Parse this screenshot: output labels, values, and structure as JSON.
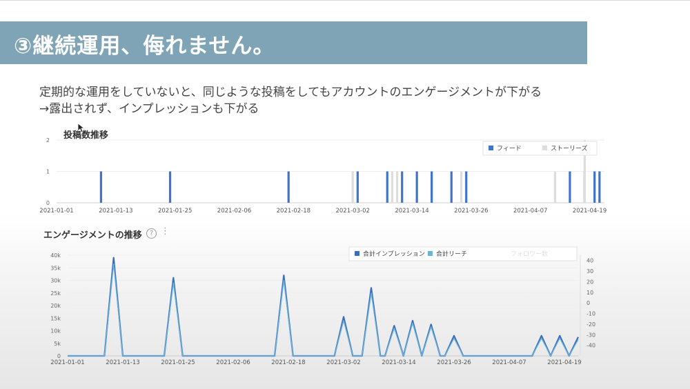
{
  "slide": {
    "title": "③継続運用、侮れません。",
    "desc_line1": "定期的な運用をしていないと、同じような投稿をしてもアカウントのエンゲージメントが下がる",
    "desc_line2": "→露出されず、インプレッションも下がる"
  },
  "icons": {
    "help": "question-circle-icon",
    "more": "vertical-dots-icon",
    "cursor": "mouse-pointer-icon"
  },
  "colors": {
    "banner": "#7fa4b5",
    "feed": "#3f74cc",
    "stories": "#dddddd",
    "impressions": "#3a6fb8",
    "reach": "#6cb3dd"
  },
  "chart_data": [
    {
      "type": "bar",
      "title": "投稿数推移",
      "x_tick_labels": [
        "2021-01-01",
        "2021-01-13",
        "2021-01-25",
        "2021-02-06",
        "2021-02-18",
        "2021-03-02",
        "2021-03-14",
        "2021-03-26",
        "2021-04-07",
        "2021-04-19"
      ],
      "x_range": [
        "2021-01-01",
        "2021-04-22"
      ],
      "y_ticks": [
        "0",
        "1",
        "2"
      ],
      "ylim": [
        0,
        2
      ],
      "legend_position": "top-right",
      "series": [
        {
          "name": "フィード",
          "color": "#3f74cc",
          "points": [
            [
              "2021-01-10",
              1
            ],
            [
              "2021-01-24",
              1
            ],
            [
              "2021-02-17",
              1
            ],
            [
              "2021-03-03",
              1
            ],
            [
              "2021-03-09",
              1
            ],
            [
              "2021-03-12",
              1
            ],
            [
              "2021-03-15",
              1
            ],
            [
              "2021-03-18",
              1
            ],
            [
              "2021-03-22",
              1
            ],
            [
              "2021-03-25",
              1
            ],
            [
              "2021-04-15",
              1
            ],
            [
              "2021-04-18",
              1
            ],
            [
              "2021-04-20",
              1
            ],
            [
              "2021-04-21",
              1
            ]
          ]
        },
        {
          "name": "ストーリーズ",
          "color": "#dddddd",
          "points": [
            [
              "2021-03-02",
              1
            ],
            [
              "2021-03-10",
              1
            ],
            [
              "2021-03-11",
              1
            ],
            [
              "2021-03-24",
              1
            ],
            [
              "2021-04-12",
              1
            ],
            [
              "2021-04-18",
              2
            ]
          ]
        }
      ]
    },
    {
      "type": "line",
      "title": "エンゲージメントの推移",
      "x_tick_labels": [
        "2021-01-01",
        "2021-01-13",
        "2021-01-25",
        "2021-02-06",
        "2021-02-18",
        "2021-03-02",
        "2021-03-14",
        "2021-03-26",
        "2021-04-07",
        "2021-04-19"
      ],
      "x_range": [
        "2021-01-01",
        "2021-04-22"
      ],
      "y_left_ticks": [
        "0",
        "5k",
        "10k",
        "15k",
        "20k",
        "25k",
        "30k",
        "35k",
        "40k"
      ],
      "ylim_left": [
        0,
        40000
      ],
      "y_right_ticks": [
        "40",
        "30",
        "20",
        "10",
        "0",
        "-10",
        "-20",
        "-30",
        "-40"
      ],
      "ylim_right": [
        -50,
        45
      ],
      "legend_position": "top-right",
      "series": [
        {
          "name": "合計インプレッション",
          "color": "#3a6fb8",
          "axis": "left",
          "x": [
            "2021-01-01",
            "2021-01-09",
            "2021-01-11",
            "2021-01-13",
            "2021-01-22",
            "2021-01-24",
            "2021-01-26",
            "2021-02-15",
            "2021-02-17",
            "2021-02-19",
            "2021-02-28",
            "2021-03-02",
            "2021-03-04",
            "2021-03-06",
            "2021-03-08",
            "2021-03-10",
            "2021-03-11",
            "2021-03-13",
            "2021-03-15",
            "2021-03-17",
            "2021-03-19",
            "2021-03-21",
            "2021-03-23",
            "2021-03-24",
            "2021-03-26",
            "2021-03-28",
            "2021-04-12",
            "2021-04-14",
            "2021-04-16",
            "2021-04-18",
            "2021-04-20",
            "2021-04-22"
          ],
          "y": [
            0,
            0,
            39000,
            0,
            0,
            31000,
            0,
            0,
            32000,
            0,
            0,
            15500,
            0,
            0,
            27000,
            0,
            0,
            12000,
            0,
            14000,
            0,
            12500,
            0,
            0,
            8000,
            0,
            0,
            8000,
            0,
            8000,
            0,
            7500
          ]
        },
        {
          "name": "合計リーチ",
          "color": "#6cb3dd",
          "axis": "left",
          "x": [
            "2021-01-01",
            "2021-01-09",
            "2021-01-11",
            "2021-01-13",
            "2021-01-22",
            "2021-01-24",
            "2021-01-26",
            "2021-02-15",
            "2021-02-17",
            "2021-02-19",
            "2021-02-28",
            "2021-03-02",
            "2021-03-04",
            "2021-03-06",
            "2021-03-08",
            "2021-03-10",
            "2021-03-11",
            "2021-03-13",
            "2021-03-15",
            "2021-03-17",
            "2021-03-19",
            "2021-03-21",
            "2021-03-23",
            "2021-03-24",
            "2021-03-26",
            "2021-03-28",
            "2021-04-12",
            "2021-04-14",
            "2021-04-16",
            "2021-04-18",
            "2021-04-20",
            "2021-04-22"
          ],
          "y": [
            0,
            0,
            36500,
            0,
            0,
            29000,
            0,
            0,
            30000,
            0,
            0,
            14000,
            0,
            0,
            25000,
            0,
            0,
            11000,
            0,
            13000,
            0,
            11500,
            0,
            0,
            7000,
            0,
            0,
            7000,
            0,
            7000,
            0,
            6500
          ]
        }
      ],
      "legend_extra": "フォロワー数"
    }
  ]
}
